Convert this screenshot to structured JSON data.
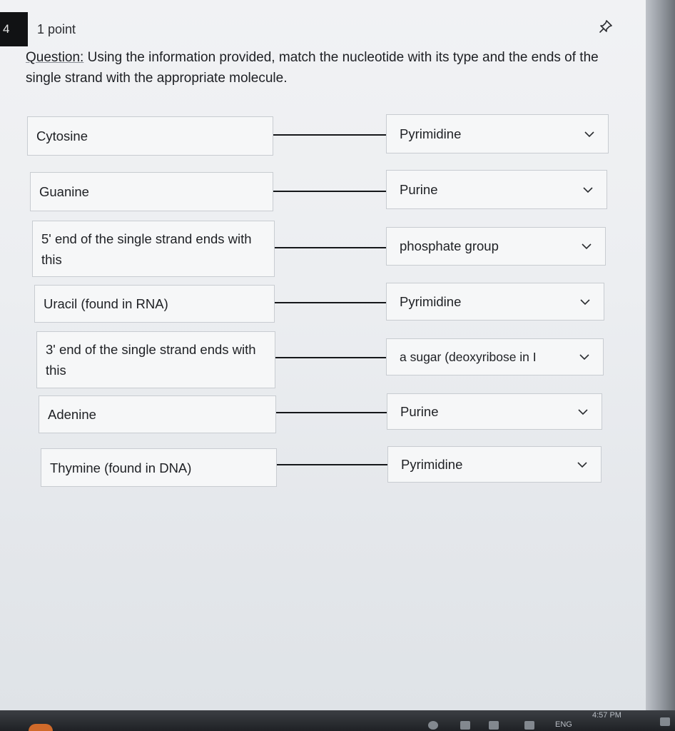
{
  "question_number": "4",
  "points": "1 point",
  "question": {
    "label": "Question:",
    "text": " Using the information provided, match the nucleotide with its type and the ends of the single strand with the appropriate molecule."
  },
  "pairs": [
    {
      "left": "Cytosine",
      "right": "Pyrimidine"
    },
    {
      "left": "Guanine",
      "right": "Purine"
    },
    {
      "left": "5' end of the single strand ends with this",
      "right": "phosphate group"
    },
    {
      "left": "Uracil (found in RNA)",
      "right": "Pyrimidine"
    },
    {
      "left": "3' end of the single strand ends with this",
      "right": "a sugar (deoxyribose in I"
    },
    {
      "left": "Adenine",
      "right": "Purine"
    },
    {
      "left": "Thymine (found in DNA)",
      "right": "Pyrimidine"
    }
  ],
  "taskbar": {
    "language": "ENG",
    "time": "4:57 PM"
  },
  "icons": {
    "pin": "pin-icon",
    "chevron": "chevron-down-icon"
  }
}
